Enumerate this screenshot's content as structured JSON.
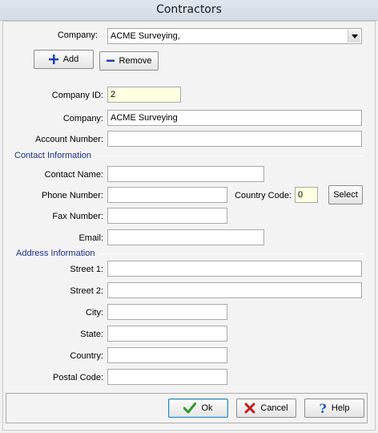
{
  "window": {
    "title": "Contractors"
  },
  "selector": {
    "label": "Company:",
    "value": "ACME Surveying,"
  },
  "actions": {
    "add_label": "Add",
    "remove_label": "Remove"
  },
  "fields": {
    "company_id": {
      "label": "Company ID:",
      "value": "2"
    },
    "company": {
      "label": "Company:",
      "value": "ACME Surveying"
    },
    "account_number": {
      "label": "Account Number:",
      "value": ""
    }
  },
  "contact": {
    "heading": "Contact Information",
    "name_label": "Contact Name:",
    "name_value": "",
    "phone_label": "Phone Number:",
    "phone_value": "",
    "country_code_label": "Country Code:",
    "country_code_value": "0",
    "select_label": "Select",
    "fax_label": "Fax Number:",
    "fax_value": "",
    "email_label": "Email:",
    "email_value": ""
  },
  "address": {
    "heading": "Address Information",
    "street1_label": "Street 1:",
    "street1_value": "",
    "street2_label": "Street 2:",
    "street2_value": "",
    "city_label": "City:",
    "city_value": "",
    "state_label": "State:",
    "state_value": "",
    "country_label": "Country:",
    "country_value": "",
    "postal_label": "Postal Code:",
    "postal_value": ""
  },
  "footer": {
    "ok_label": "Ok",
    "cancel_label": "Cancel",
    "help_label": "Help"
  },
  "colors": {
    "section_heading": "#1c2e88",
    "id_field_bg": "#ffffe1",
    "add_icon": "#1f3fb0",
    "ok_icon": "#2e9a2e",
    "cancel_icon": "#c41c1c",
    "help_icon": "#1f5fc0"
  }
}
